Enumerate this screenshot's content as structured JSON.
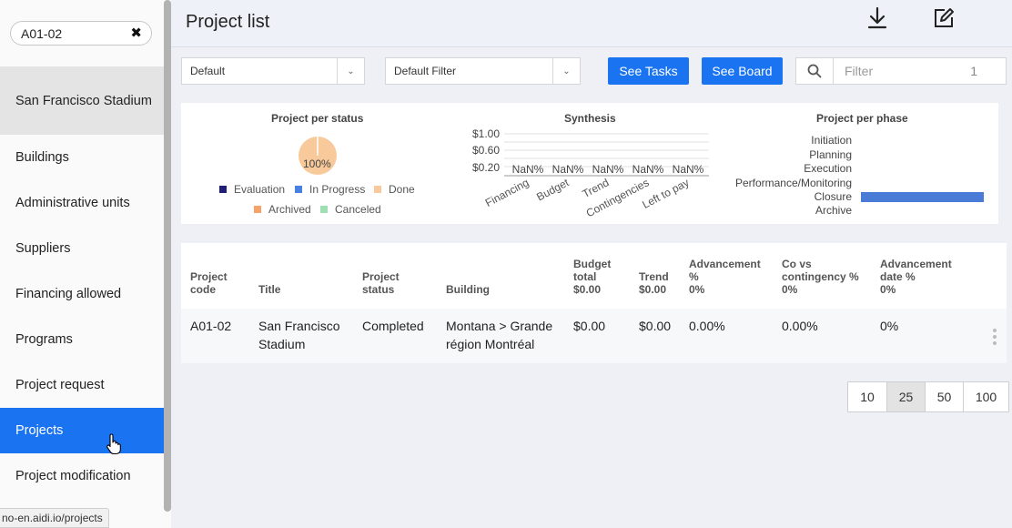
{
  "sidebar": {
    "search_value": "A01-02",
    "clear_glyph": "✖",
    "project_name": "San Francisco Stadium",
    "items": [
      {
        "label": "Buildings"
      },
      {
        "label": "Administrative units"
      },
      {
        "label": "Suppliers"
      },
      {
        "label": "Financing allowed"
      },
      {
        "label": "Programs"
      },
      {
        "label": "Project request"
      },
      {
        "label": "Projects",
        "active": true
      },
      {
        "label": "Project modification"
      }
    ],
    "status_url": "no-en.aidi.io/projects"
  },
  "header": {
    "title": "Project list",
    "icons": [
      "download-icon",
      "edit-icon"
    ]
  },
  "toolbar": {
    "view_select": "Default",
    "filter_select": "Default Filter",
    "see_tasks": "See Tasks",
    "see_board": "See Board",
    "filter_placeholder": "Filter",
    "filter_count": "1"
  },
  "colors": {
    "accent": "#1a73f0",
    "evaluation": "#1f1f7a",
    "in_progress": "#4a80e0",
    "done": "#f8c99a",
    "archived": "#f4a46a",
    "canceled": "#9ee0b4",
    "phase_bar": "#4a7bd6"
  },
  "chart_data": [
    {
      "type": "pie",
      "title": "Project per status",
      "categories": [
        "Evaluation",
        "In Progress",
        "Done",
        "Archived",
        "Canceled"
      ],
      "values": [
        0,
        0,
        100,
        0,
        0
      ],
      "data_labels": [
        "100%"
      ]
    },
    {
      "type": "bar",
      "title": "Synthesis",
      "categories": [
        "Financing",
        "Budget",
        "Trend",
        "Contingencies",
        "Left to pay"
      ],
      "values": [
        null,
        null,
        null,
        null,
        null
      ],
      "data_labels": [
        "NaN%",
        "NaN%",
        "NaN%",
        "NaN%",
        "NaN%"
      ],
      "y_ticks": [
        "$1.00",
        "$0.60",
        "$0.20"
      ],
      "grid": true
    },
    {
      "type": "bar",
      "orientation": "horizontal",
      "title": "Project per phase",
      "categories": [
        "Initiation",
        "Planning",
        "Execution",
        "Performance/Monitoring",
        "Closure",
        "Archive"
      ],
      "values": [
        0,
        0,
        0,
        0,
        1,
        0
      ]
    }
  ],
  "table": {
    "headers": [
      {
        "lines": [
          "Project",
          "code"
        ]
      },
      {
        "lines": [
          "Title"
        ]
      },
      {
        "lines": [
          "Project",
          "status"
        ]
      },
      {
        "lines": [
          "Building"
        ]
      },
      {
        "lines": [
          "Budget",
          "total",
          "$0.00"
        ]
      },
      {
        "lines": [
          "Trend",
          "$0.00"
        ]
      },
      {
        "lines": [
          "Advancement",
          "%",
          "0%"
        ]
      },
      {
        "lines": [
          "Co vs",
          "contingency %",
          "0%"
        ]
      },
      {
        "lines": [
          "Advancement",
          "date %",
          "0%"
        ]
      }
    ],
    "rows": [
      {
        "code": "A01-02",
        "title": [
          "San Francisco",
          "Stadium"
        ],
        "status": "Completed",
        "building": [
          "Montana > Grande",
          "région Montréal"
        ],
        "budget": "$0.00",
        "trend": "$0.00",
        "advancement": "0.00%",
        "co_vs": "0.00%",
        "advancement_date": "0%"
      }
    ]
  },
  "pagination": {
    "sizes": [
      "10",
      "25",
      "50",
      "100"
    ],
    "active": "25"
  }
}
